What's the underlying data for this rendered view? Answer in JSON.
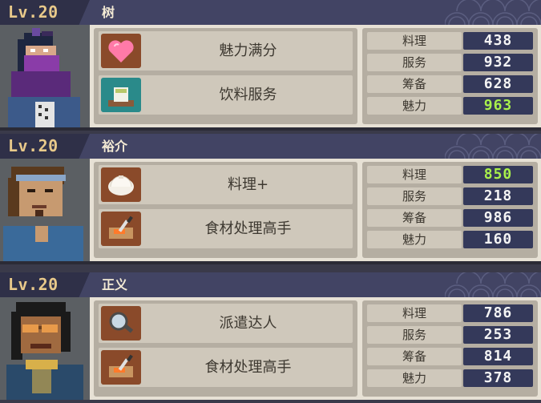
{
  "stat_labels": [
    "料理",
    "服务",
    "筹备",
    "魅力"
  ],
  "characters": [
    {
      "level": "Lv.20",
      "name": "树",
      "skills": [
        {
          "label": "魅力满分",
          "icon": "heart-icon"
        },
        {
          "label": "饮料服务",
          "icon": "teacup-icon"
        }
      ],
      "stats": [
        "438",
        "932",
        "628",
        "963"
      ],
      "highlight_index": 3
    },
    {
      "level": "Lv.20",
      "name": "裕介",
      "skills": [
        {
          "label": "料理+",
          "icon": "dumpling-icon"
        },
        {
          "label": "食材处理高手",
          "icon": "cutting-board-icon"
        }
      ],
      "stats": [
        "850",
        "218",
        "986",
        "160"
      ],
      "highlight_index": 0
    },
    {
      "level": "Lv.20",
      "name": "正义",
      "skills": [
        {
          "label": "派遣达人",
          "icon": "magnifier-icon"
        },
        {
          "label": "食材处理高手",
          "icon": "cutting-board-icon"
        }
      ],
      "stats": [
        "786",
        "253",
        "814",
        "378"
      ],
      "highlight_index": -1
    }
  ],
  "colors": {
    "header": "#424464",
    "level_text": "#e8c98a",
    "value_box": "#34395a",
    "highlight_value": "#a8f04b"
  }
}
